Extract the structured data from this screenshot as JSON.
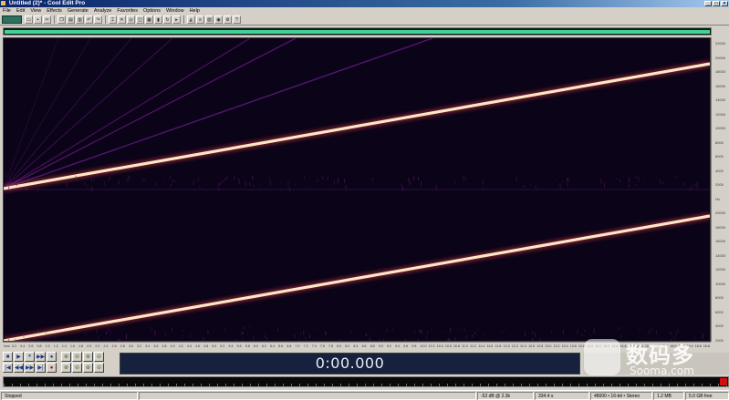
{
  "window": {
    "title": "Untitled (2)* - Cool Edit Pro",
    "controls": [
      "_",
      "□",
      "×"
    ]
  },
  "menu": [
    "File",
    "Edit",
    "View",
    "Effects",
    "Generate",
    "Analyze",
    "Favorites",
    "Options",
    "Window",
    "Help"
  ],
  "toolbar": {
    "icons": [
      "waveform-view-icon",
      "open-icon",
      "save-icon",
      "cut-icon",
      "copy-icon",
      "paste-icon",
      "mix-paste-icon",
      "undo-icon",
      "redo-icon",
      "select-icon",
      "hybrid-icon",
      "zoom-icon",
      "scrub-icon",
      "spectral-icon",
      "marker-icon",
      "loop-icon",
      "cue-icon",
      "metronome-icon",
      "multitrack-icon",
      "edit-view-icon",
      "cd-icon",
      "settings-icon",
      "help-icon"
    ]
  },
  "frequency_ruler": {
    "labels": [
      "22000",
      "20000",
      "18000",
      "16000",
      "14000",
      "12000",
      "10000",
      "8000",
      "6000",
      "4000",
      "2000",
      "Hz",
      "20000",
      "18000",
      "16000",
      "14000",
      "12000",
      "10000",
      "8000",
      "6000",
      "4000",
      "2000"
    ]
  },
  "time_ruler": {
    "labels": [
      "hms",
      "0.2",
      "0.4",
      "0.6",
      "0.8",
      "1.0",
      "1.2",
      "1.4",
      "1.6",
      "1.8",
      "2.0",
      "2.2",
      "2.4",
      "2.6",
      "2.8",
      "3.0",
      "3.2",
      "3.4",
      "3.6",
      "3.8",
      "4.0",
      "4.2",
      "4.4",
      "4.6",
      "4.8",
      "5.0",
      "5.2",
      "5.4",
      "5.6",
      "5.8",
      "6.0",
      "6.2",
      "6.4",
      "6.6",
      "6.8",
      "7.0",
      "7.2",
      "7.4",
      "7.6",
      "7.8",
      "8.0",
      "8.2",
      "8.4",
      "8.6",
      "8.8",
      "9.0",
      "9.2",
      "9.4",
      "9.6",
      "9.8",
      "10.0",
      "10.2",
      "10.4",
      "10.6",
      "10.8",
      "11.0",
      "11.2",
      "11.4",
      "11.6",
      "11.8",
      "12.0",
      "12.2",
      "12.4",
      "12.6",
      "12.8",
      "13.0",
      "13.2",
      "13.4",
      "13.6",
      "13.8",
      "14.0",
      "14.2",
      "14.4",
      "14.6",
      "14.8",
      "15.0",
      "15.2",
      "15.4",
      "15.6",
      "15.8",
      "16.0",
      "16.2",
      "16.4",
      "16.6",
      "16.8"
    ]
  },
  "transport": {
    "row1": [
      "■",
      "▶",
      "⏸",
      "▶▶",
      "●"
    ],
    "row2": [
      "|◀",
      "◀◀",
      "▶▶",
      "▶|",
      "●"
    ],
    "zoom_row1": [
      "⊕",
      "⊖",
      "⊕",
      "⊖"
    ],
    "zoom_row2": [
      "⊕",
      "⊖",
      "⊕",
      "⊖"
    ]
  },
  "time_display": "0:00.000",
  "status": {
    "state": "Stopped",
    "level": "-52 dB @ 2.3k",
    "free_time": "334.4 s",
    "format": "48000 • 16-bit • Stereo",
    "size": "1.2 MB",
    "disk": "5.0 GB free"
  },
  "watermark": {
    "brand_cn": "数码多",
    "brand_url": "Sooma.com"
  },
  "colors": {
    "spectro_bg": "#0b0318",
    "sweep_main": "#ffe8d0",
    "harmonic": "#8a2aa8",
    "overview_range": "#3fd39a"
  }
}
